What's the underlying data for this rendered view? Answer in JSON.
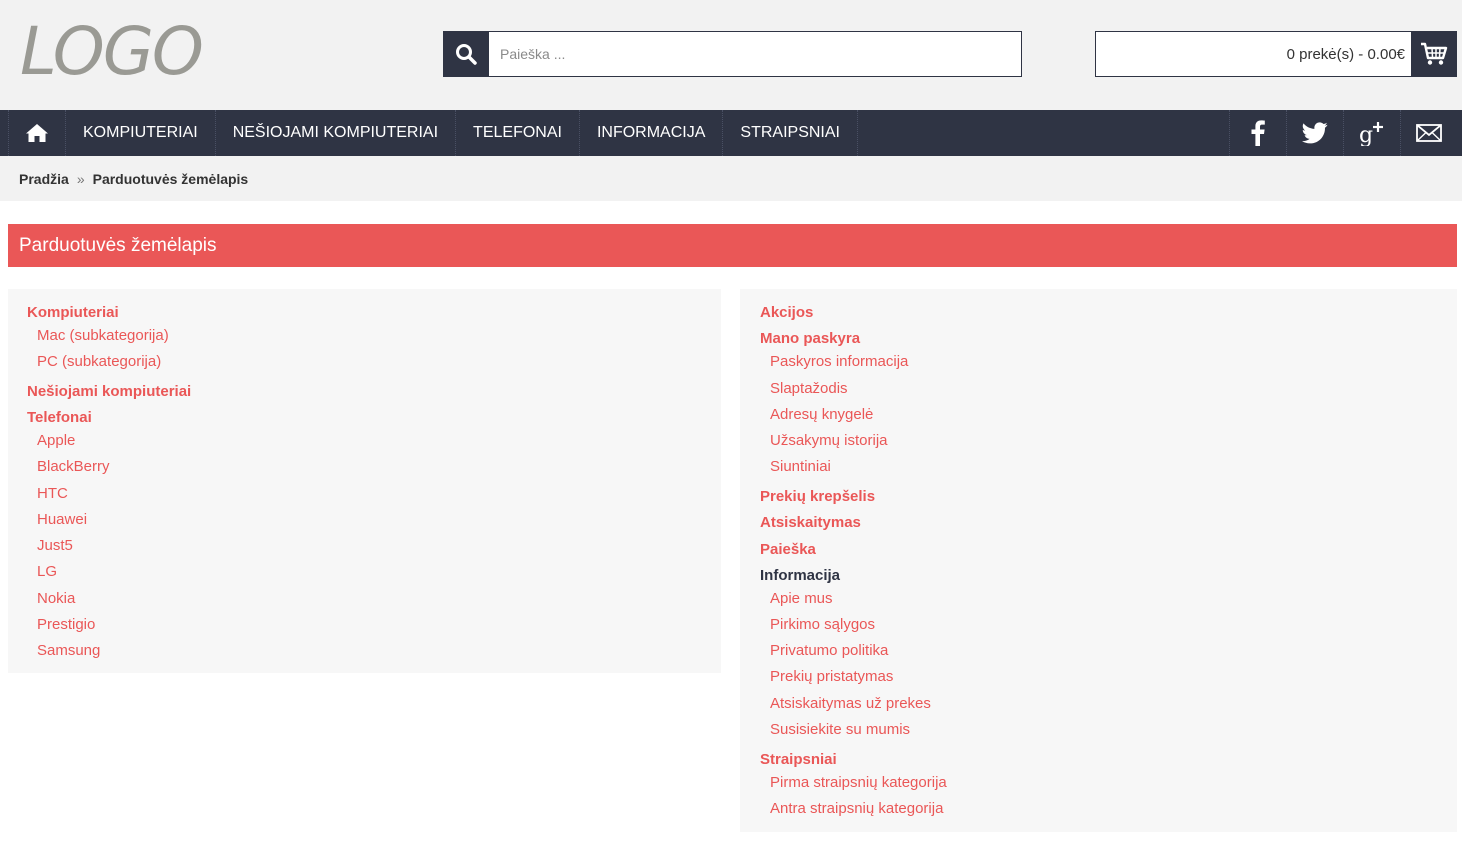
{
  "header": {
    "logo_text": "LOGO",
    "search": {
      "placeholder": "Paieška ..."
    },
    "cart": {
      "summary": "0 prekė(s) - 0.00€"
    }
  },
  "nav": {
    "items": [
      {
        "label": "KOMPIUTERIAI"
      },
      {
        "label": "NEŠIOJAMI KOMPIUTERIAI"
      },
      {
        "label": "TELEFONAI"
      },
      {
        "label": "INFORMACIJA"
      },
      {
        "label": "STRAIPSNIAI"
      }
    ],
    "social": [
      "facebook-icon",
      "twitter-icon",
      "google-plus-icon",
      "email-icon"
    ]
  },
  "breadcrumb": {
    "home": "Pradžia",
    "separator": "»",
    "current": "Parduotuvės žemėlapis"
  },
  "page_title": "Parduotuvės žemėlapis",
  "sitemap": {
    "left": {
      "computers": {
        "label": "Kompiuteriai",
        "children": [
          "Mac (subkategorija)",
          "PC (subkategorija)"
        ]
      },
      "laptops": {
        "label": "Nešiojami kompiuteriai"
      },
      "phones": {
        "label": "Telefonai",
        "children": [
          "Apple",
          "BlackBerry",
          "HTC",
          "Huawei",
          "Just5",
          "LG",
          "Nokia",
          "Prestigio",
          "Samsung"
        ]
      }
    },
    "right": {
      "specials": {
        "label": "Akcijos"
      },
      "account": {
        "label": "Mano paskyra",
        "children": [
          "Paskyros informacija",
          "Slaptažodis",
          "Adresų knygelė",
          "Užsakymų istorija",
          "Siuntiniai"
        ]
      },
      "cart": {
        "label": "Prekių krepšelis"
      },
      "checkout": {
        "label": "Atsiskaitymas"
      },
      "search": {
        "label": "Paieška"
      },
      "information": {
        "label": "Informacija",
        "children": [
          "Apie mus",
          "Pirkimo sąlygos",
          "Privatumo politika",
          "Prekių pristatymas",
          "Atsiskaitymas už prekes",
          "Susisiekite su mumis"
        ]
      },
      "articles": {
        "label": "Straipsniai",
        "children": [
          "Pirma straipsnių kategorija",
          "Antra straipsnių kategorija"
        ]
      }
    }
  },
  "colors": {
    "accent": "#ea5757",
    "dark": "#2f3444",
    "light_bg": "#f2f2f2",
    "panel_bg": "#f7f7f7"
  }
}
